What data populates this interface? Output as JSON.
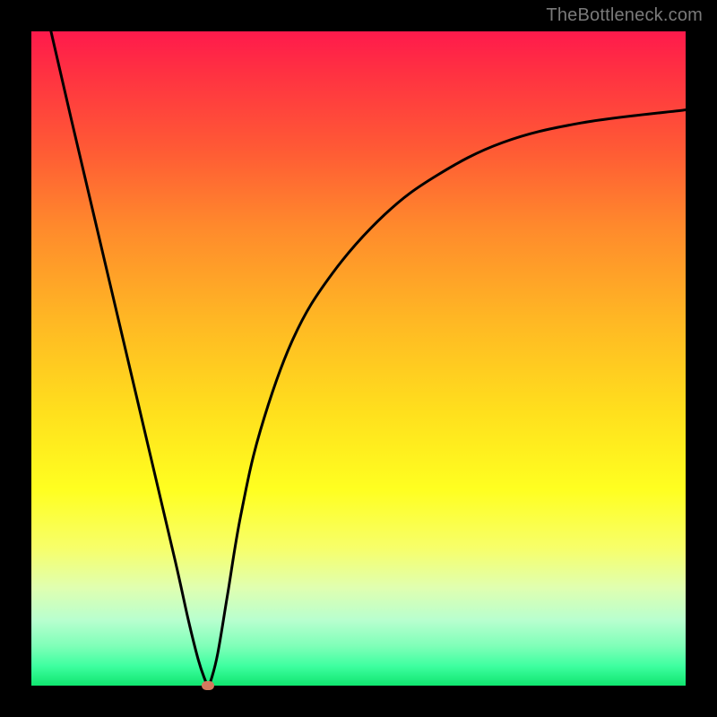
{
  "watermark": "TheBottleneck.com",
  "chart_data": {
    "type": "line",
    "title": "",
    "xlabel": "",
    "ylabel": "",
    "xlim": [
      0,
      100
    ],
    "ylim": [
      0,
      100
    ],
    "grid": false,
    "legend": false,
    "series": [
      {
        "name": "curve",
        "color": "#000000",
        "x": [
          3,
          6,
          10,
          14,
          18,
          22,
          24,
          25.5,
          26.5,
          27,
          27.5,
          28.5,
          30,
          32,
          35,
          40,
          46,
          54,
          62,
          72,
          84,
          100
        ],
        "y": [
          100,
          87,
          70,
          53,
          36,
          19,
          10,
          4,
          1,
          0,
          1,
          5,
          14,
          26,
          39,
          53,
          63,
          72,
          78,
          83,
          86,
          88
        ]
      }
    ],
    "marker": {
      "x": 27,
      "y": 0
    },
    "background": "red-to-green vertical gradient"
  }
}
